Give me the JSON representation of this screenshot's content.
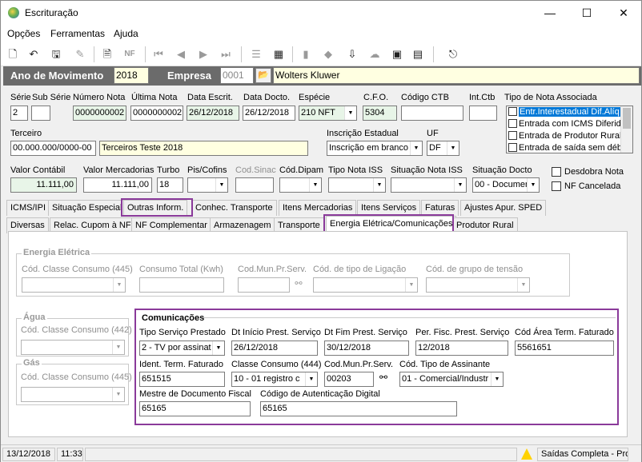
{
  "window": {
    "title": "Escrituração",
    "minimize": "—",
    "maximize": "☐",
    "close": "✕"
  },
  "menu": {
    "opcoes": "Opções",
    "ferramentas": "Ferramentas",
    "ajuda": "Ajuda"
  },
  "toolbar_icons": [
    "new-document-icon",
    "undo-icon",
    "save-icon",
    "delete-icon",
    "print-preview-icon",
    "nfe-icon",
    "first-record-icon",
    "previous-record-icon",
    "next-record-icon",
    "last-record-icon",
    "list-icon",
    "calculator-icon",
    "folder-icon",
    "tag-icon",
    "import-icon",
    "cloud-icon",
    "cib-icon",
    "device-icon",
    "exit-icon"
  ],
  "header": {
    "ano_label": "Ano de Movimento",
    "ano_value": "2018",
    "empresa_label": "Empresa",
    "empresa_code": "0001",
    "empresa_name": "Wolters Kluwer"
  },
  "row1": {
    "serie_label": "Série",
    "serie": "2",
    "subserie_label": "Sub Série",
    "subserie": "",
    "numero_label": "Número Nota",
    "numero": "0000000002",
    "ultima_label": "Última Nota",
    "ultima": "0000000002",
    "data_escrit_label": "Data Escrit.",
    "data_escrit": "26/12/2018",
    "data_docto_label": "Data Docto.",
    "data_docto": "26/12/2018",
    "especie_label": "Espécie",
    "especie": "210  NFT",
    "cfo_label": "C.F.O.",
    "cfo": "5304",
    "codigo_ctb_label": "Código CTB",
    "codigo_ctb": "",
    "int_ctb_label": "Int.Ctb",
    "int_ctb": ""
  },
  "tipo_nota": {
    "label": "Tipo de Nota Associada",
    "items": [
      "Entr.Interestadual Dif.Alíq",
      "Entrada com ICMS Diferido",
      "Entrada de Produtor Rural",
      "Entrada de saída sem débi"
    ]
  },
  "terceiro": {
    "label": "Terceiro",
    "code": "00.000.000/0000-00",
    "name": "Terceiros Teste 2018"
  },
  "inscricao": {
    "label": "Inscrição Estadual",
    "value": "Inscrição em branco"
  },
  "uf": {
    "label": "UF",
    "value": "DF"
  },
  "row3": {
    "valor_contabil_label": "Valor Contábil",
    "valor_contabil": "11.111,00",
    "valor_merc_label": "Valor Mercadorias",
    "valor_merc": "11.111,00",
    "turbo_label": "Turbo",
    "turbo": "18",
    "pis_label": "Pis/Cofins",
    "pis": "",
    "cod_sinac_label": "Cod.Sinac",
    "cod_sinac": "",
    "cod_dipam_label": "Cód.Dipam",
    "cod_dipam": "",
    "tipo_iss_label": "Tipo Nota ISS",
    "tipo_iss": "",
    "sit_iss_label": "Situação Nota ISS",
    "sit_iss": "",
    "sit_docto_label": "Situação Docto",
    "sit_docto": "00 - Documen",
    "desdobra_label": "Desdobra Nota",
    "cancelada_label": "NF Cancelada"
  },
  "tabs1": [
    "ICMS/IPI",
    "Situação Especial",
    "Outras Inform.",
    "Conhec. Transporte",
    "Itens Mercadorias",
    "Itens Serviços",
    "Faturas",
    "Ajustes Apur. SPED"
  ],
  "tabs2": [
    "Diversas",
    "Relac. Cupom à NF",
    "NF Complementar",
    "Armazenagem",
    "Transporte",
    "Energia Elétrica/Comunicações",
    "Produtor Rural"
  ],
  "energia": {
    "title": "Energia Elétrica",
    "classe_label": "Cód. Classe Consumo (445)",
    "classe": "",
    "consumo_label": "Consumo Total (Kwh)",
    "consumo": "",
    "codmun_label": "Cod.Mun.Pr.Serv.",
    "codmun": "",
    "ligacao_label": "Cód. de tipo de Ligação",
    "ligacao": "",
    "tensao_label": "Cód. de grupo de tensão",
    "tensao": ""
  },
  "agua": {
    "title": "Água",
    "classe_label": "Cód. Classe Consumo (442)",
    "classe": ""
  },
  "gas": {
    "title": "Gás",
    "classe_label": "Cód. Classe Consumo (445)",
    "classe": ""
  },
  "comunicacoes": {
    "title": "Comunicações",
    "tipo_servico_label": "Tipo Serviço Prestado",
    "tipo_servico": "2 - TV por assinat",
    "dt_inicio_label": "Dt Início Prest. Serviço",
    "dt_inicio": "26/12/2018",
    "dt_fim_label": "Dt Fim Prest. Serviço",
    "dt_fim": "30/12/2018",
    "per_fisc_label": "Per. Fisc. Prest. Serviço",
    "per_fisc": "12/2018",
    "cod_area_label": "Cód Área Term. Faturado",
    "cod_area": "5561651",
    "ident_label": "Ident. Term. Faturado",
    "ident": "651515",
    "classe_label": "Classe Consumo (444)",
    "classe": "10 - 01 registro c",
    "codmun_label": "Cod.Mun.Pr.Serv.",
    "codmun": "00203",
    "tipo_assinante_label": "Cód. Tipo de Assinante",
    "tipo_assinante": "01 - Comercial/Industr",
    "mestre_label": "Mestre de Documento Fiscal",
    "mestre": "65165",
    "autent_label": "Código de Autenticação Digital",
    "autent": "65165"
  },
  "status": {
    "date": "13/12/2018",
    "time": "11:33",
    "message": "Saídas Completa - Pros"
  },
  "colors": {
    "band": "#6b6b6b",
    "highlight": "#8a3a9a",
    "selection": "#0078d7",
    "yellow_input": "#ffffe1",
    "green_input": "#e8f5e8"
  }
}
